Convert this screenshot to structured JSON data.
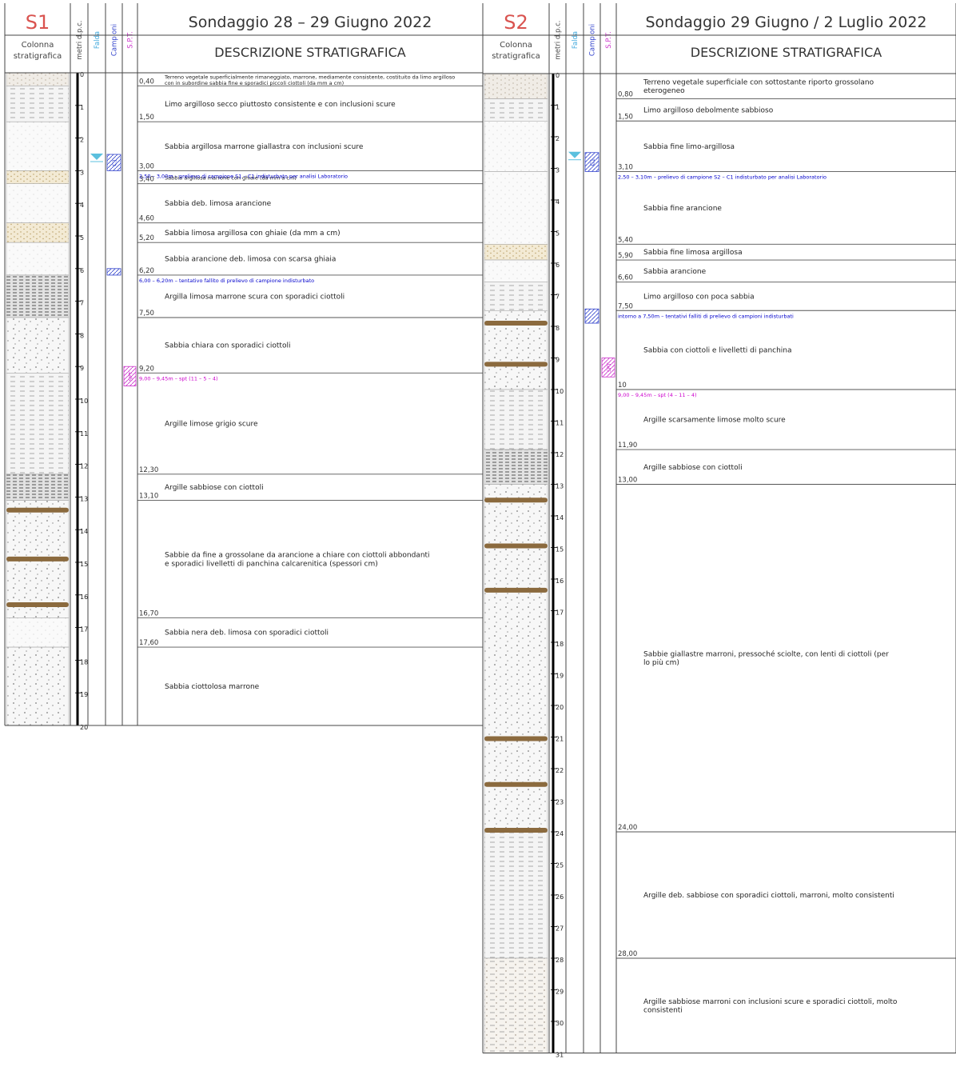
{
  "logs": [
    {
      "id": "S1",
      "title": "Sondaggio 28  –  29 Giugno 2022",
      "headers": {
        "colonna_line1": "Colonna",
        "colonna_line2": "stratigrafica",
        "metri": "metri d.p.c.",
        "falda": "Falda",
        "campioni": "Campioni",
        "spt": "S.P.T.",
        "descrizione": "DESCRIZIONE STRATIGRAFICA"
      },
      "total_depth": 20,
      "ticks": [
        "0",
        "1",
        "2",
        "3",
        "4",
        "5",
        "6",
        "7",
        "8",
        "9",
        "10",
        "11",
        "12",
        "13",
        "14",
        "15",
        "16",
        "17",
        "18",
        "19",
        "20"
      ],
      "water_table_depth": 2.55,
      "layers": [
        {
          "from": 0.0,
          "to": 0.4,
          "bottom_label": "0,40",
          "pattern": "fill",
          "desc": "Terreno vegetale superficialmente rimaneggiato, marrone, mediamente consistente, costituito da limo argilloso con in subordine sabbia fine e sporadici piccoli ciottoli (da mm a cm)"
        },
        {
          "from": 0.4,
          "to": 1.5,
          "bottom_label": "1,50",
          "pattern": "silt",
          "desc": "Limo argilloso secco piuttosto consistente e con inclusioni scure"
        },
        {
          "from": 1.5,
          "to": 3.0,
          "bottom_label": "3,00",
          "pattern": "sand",
          "desc": "Sabbia argillosa marrone giallastra con inclusioni scure"
        },
        {
          "from": 3.0,
          "to": 3.4,
          "bottom_label": "3,40",
          "pattern": "gravel",
          "desc": "Sabbia argillosa marrone con ghiaie (da mm a cm)"
        },
        {
          "from": 3.4,
          "to": 4.6,
          "bottom_label": "4,60",
          "pattern": "sand",
          "desc": "Sabbia deb. limosa arancione"
        },
        {
          "from": 4.6,
          "to": 5.2,
          "bottom_label": "5,20",
          "pattern": "gravel",
          "desc": "Sabbia limosa argillosa con ghiaie (da mm a cm)"
        },
        {
          "from": 5.2,
          "to": 6.2,
          "bottom_label": "6,20",
          "pattern": "sand",
          "desc": "Sabbia arancione deb. limosa con scarsa ghiaia"
        },
        {
          "from": 6.2,
          "to": 7.5,
          "bottom_label": "7,50",
          "pattern": "clay",
          "desc": "Argilla limosa marrone scura con sporadici ciottoli"
        },
        {
          "from": 7.5,
          "to": 9.2,
          "bottom_label": "9,20",
          "pattern": "pebbles",
          "desc": "Sabbia chiara con sporadici ciottoli"
        },
        {
          "from": 9.2,
          "to": 12.3,
          "bottom_label": "12,30",
          "pattern": "silt",
          "desc": "Argille limose grigio scure"
        },
        {
          "from": 12.3,
          "to": 13.1,
          "bottom_label": "13,10",
          "pattern": "clay",
          "desc": "Argille sabbiose con ciottoli"
        },
        {
          "from": 13.1,
          "to": 16.7,
          "bottom_label": "16,70",
          "pattern": "pebbles",
          "desc": "Sabbie da fine a grossolane da arancione a chiare con ciottoli abbondanti e sporadici livelletti di panchina calcarenitica (spessori cm)"
        },
        {
          "from": 16.7,
          "to": 17.6,
          "bottom_label": "17,60",
          "pattern": "sand",
          "desc": "Sabbia nera deb. limosa con sporadici ciottoli"
        },
        {
          "from": 17.6,
          "to": 20.0,
          "bottom_label": "",
          "pattern": "pebbles",
          "desc": "Sabbia ciottolosa marrone"
        }
      ],
      "panchina_depths": [
        13.4,
        14.9,
        16.3
      ],
      "notes": [
        {
          "depth": 3.0,
          "text": "2,50 – 3,00m – prelievo di campione S1 – C1 indisturbato per analisi Laboratorio",
          "color": "#0000cc"
        },
        {
          "depth": 6.2,
          "text": "6,00 – 6,20m – tentativo fallito di prelievo di campione indisturbato",
          "color": "#0000cc"
        },
        {
          "depth": 9.2,
          "text": "9,00 – 9,45m – spt (11 – 5 – 4)",
          "color": "#cc00cc"
        }
      ],
      "samples": [
        {
          "from": 2.5,
          "to": 3.0,
          "label": "C1"
        },
        {
          "from": 6.0,
          "to": 6.2,
          "label": ""
        }
      ],
      "spt": [
        {
          "from": 9.0,
          "to": 9.45,
          "label": "SPT"
        }
      ]
    },
    {
      "id": "S2",
      "title": "Sondaggio 29 Giugno / 2 Luglio 2022",
      "headers": {
        "colonna_line1": "Colonna",
        "colonna_line2": "stratigrafica",
        "metri": "metri d.p.c.",
        "falda": "Falda",
        "campioni": "Campioni",
        "spt": "S.P.T.",
        "descrizione": "DESCRIZIONE STRATIGRAFICA"
      },
      "total_depth": 31,
      "ticks": [
        "0",
        "1",
        "2",
        "3",
        "4",
        "5",
        "6",
        "7",
        "8",
        "9",
        "10",
        "11",
        "12",
        "13",
        "14",
        "15",
        "16",
        "17",
        "18",
        "19",
        "20",
        "21",
        "22",
        "23",
        "24",
        "25",
        "26",
        "27",
        "28",
        "29",
        "30",
        "31"
      ],
      "water_table_depth": 2.55,
      "layers": [
        {
          "from": 0.0,
          "to": 0.8,
          "bottom_label": "0,80",
          "pattern": "fill",
          "desc": "Terreno vegetale superficiale con sottostante riporto grossolano eterogeneo"
        },
        {
          "from": 0.8,
          "to": 1.5,
          "bottom_label": "1,50",
          "pattern": "silt",
          "desc": "Limo argilloso debolmente sabbioso"
        },
        {
          "from": 1.5,
          "to": 3.1,
          "bottom_label": "3,10",
          "pattern": "sand",
          "desc": "Sabbia fine limo-argillosa"
        },
        {
          "from": 3.1,
          "to": 5.4,
          "bottom_label": "5,40",
          "pattern": "sand",
          "desc": "Sabbia fine arancione"
        },
        {
          "from": 5.4,
          "to": 5.9,
          "bottom_label": "5,90",
          "pattern": "gravel",
          "desc": "Sabbia fine limosa argillosa"
        },
        {
          "from": 5.9,
          "to": 6.6,
          "bottom_label": "6,60",
          "pattern": "sand",
          "desc": "Sabbia arancione"
        },
        {
          "from": 6.6,
          "to": 7.5,
          "bottom_label": "7,50",
          "pattern": "silt",
          "desc": "Limo argilloso con poca sabbia"
        },
        {
          "from": 7.5,
          "to": 10.0,
          "bottom_label": "10",
          "pattern": "pebbles",
          "desc": "Sabbia con ciottoli e livelletti di panchina"
        },
        {
          "from": 10.0,
          "to": 11.9,
          "bottom_label": "11,90",
          "pattern": "silt",
          "desc": "Argille scarsamente limose molto scure"
        },
        {
          "from": 11.9,
          "to": 13.0,
          "bottom_label": "13,00",
          "pattern": "clay",
          "desc": "Argille sabbiose con ciottoli"
        },
        {
          "from": 13.0,
          "to": 24.0,
          "bottom_label": "24,00",
          "pattern": "pebbles",
          "desc": "Sabbie giallastre marroni, pressoché sciolte, con lenti di ciottoli (per lo più cm)"
        },
        {
          "from": 24.0,
          "to": 28.0,
          "bottom_label": "28,00",
          "pattern": "silt",
          "desc": "Argille deb. sabbiose con sporadici ciottoli, marroni, molto consistenti"
        },
        {
          "from": 28.0,
          "to": 31.0,
          "bottom_label": "",
          "pattern": "siltdots",
          "desc": "Argille sabbiose marroni con inclusioni scure e sporadici ciottoli, molto consistenti"
        }
      ],
      "panchina_depths": [
        7.9,
        9.2,
        13.5,
        14.95,
        16.35,
        21.05,
        22.5,
        23.95
      ],
      "notes": [
        {
          "depth": 3.1,
          "text": "2,50 – 3,10m – prelievo di campione S2 – C1 indisturbato per analisi Laboratorio",
          "color": "#0000cc"
        },
        {
          "depth": 7.5,
          "text": "intorno a 7,50m – tentativi falliti di prelievo di campioni indisturbati",
          "color": "#0000cc"
        },
        {
          "depth": 10.0,
          "text": "9,00 – 9,45m – spt (4 – 11 – 4)",
          "color": "#cc00cc"
        }
      ],
      "samples": [
        {
          "from": 2.5,
          "to": 3.1,
          "label": "C1"
        },
        {
          "from": 7.45,
          "to": 7.9,
          "label": ""
        }
      ],
      "spt": [
        {
          "from": 9.0,
          "to": 9.45,
          "label": "SPT"
        }
      ]
    }
  ]
}
